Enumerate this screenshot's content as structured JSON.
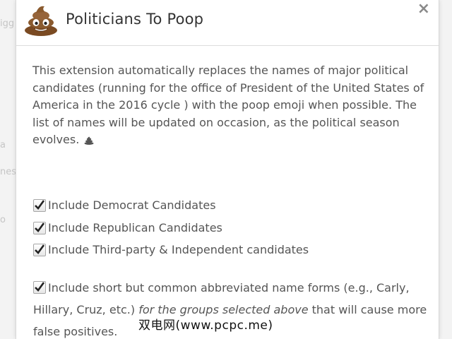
{
  "background": {
    "fragments": [
      "igg",
      "a",
      "nes",
      "o"
    ]
  },
  "dialog": {
    "logo_icon": "poop-emoji-icon",
    "title": "Politicians To Poop",
    "close_label": "×",
    "description": "This extension automatically replaces the names of major political candidates (running for the office of President of the United States of America in the 2016 cycle ) with the poop emoji when possible. The list of names will be updated on occasion, as the political season evolves.",
    "options": [
      {
        "label": "Include Democrat Candidates",
        "checked": true
      },
      {
        "label": "Include Republican Candidates",
        "checked": true
      },
      {
        "label": "Include Third-party & Independent candidates",
        "checked": true
      }
    ],
    "abbrev_option": {
      "checked": true,
      "text_before": "Include short but common abbreviated name forms (e.g., Carly, Hillary, Cruz, etc.) ",
      "text_italic": "for the groups selected above",
      "text_after": " that will cause more false positives."
    }
  },
  "watermark": "双电网(www.pcpc.me)",
  "colors": {
    "text": "#555555",
    "title": "#333333",
    "divider": "#dcdcdc",
    "poop_brown": "#8a5a2e"
  }
}
